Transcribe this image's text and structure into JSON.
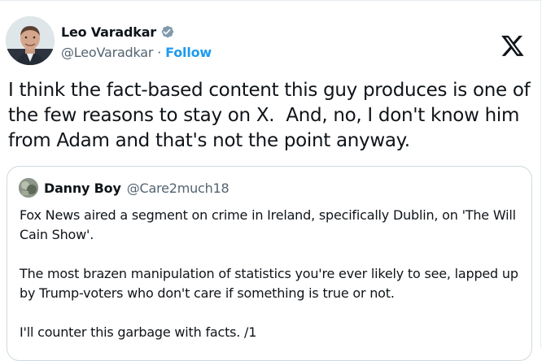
{
  "author": {
    "name": "Leo Varadkar",
    "handle": "@LeoVaradkar",
    "separator": "·",
    "follow_label": "Follow"
  },
  "tweet": {
    "text": "I think the fact-based content this guy produces is one of the few reasons to stay on X.  And, no, I don't know him from Adam and that's not the point anyway."
  },
  "quoted": {
    "name": "Danny Boy",
    "handle": "@Care2much18",
    "paragraphs": [
      "Fox News aired a segment on crime in Ireland, specifically Dublin, on 'The Will Cain Show'.",
      "The most brazen manipulation of statistics you're ever likely to see, lapped up by Trump-voters who don't care if something is true or not.",
      "I'll counter this garbage with facts. /1"
    ]
  },
  "colors": {
    "accent": "#1d9bf0",
    "text": "#0f1419",
    "secondary": "#536471",
    "border": "#cfd9de"
  },
  "icons": {
    "verified": "verified-badge-icon",
    "brand": "x-logo-icon"
  }
}
